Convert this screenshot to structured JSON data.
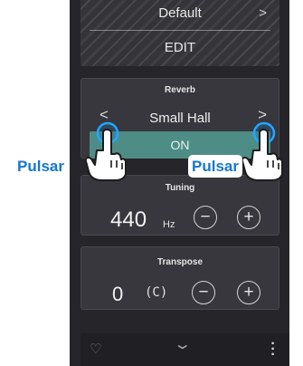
{
  "sound": {
    "name": "Default",
    "edit_label": "EDIT"
  },
  "reverb": {
    "title": "Reverb",
    "value": "Small Hall",
    "on_label": "ON"
  },
  "tuning": {
    "title": "Tuning",
    "value": "440",
    "unit": "Hz",
    "minus": "−",
    "plus": "+"
  },
  "transpose": {
    "title": "Transpose",
    "value": "0",
    "note": "(C)",
    "minus": "−",
    "plus": "+"
  },
  "annotations": {
    "left_label": "Pulsar",
    "right_label": "Pulsar"
  },
  "icons": {
    "chevrons": [
      "chevron-left-icon",
      "chevron-right-icon"
    ],
    "bottom": [
      "heart-icon",
      "chevron-down-icon",
      "menu-dots-icon"
    ]
  },
  "colors": {
    "accent": "#4e8d86",
    "callout_text": "#1677cc",
    "panel": "#37373d",
    "background": "#26262a"
  }
}
